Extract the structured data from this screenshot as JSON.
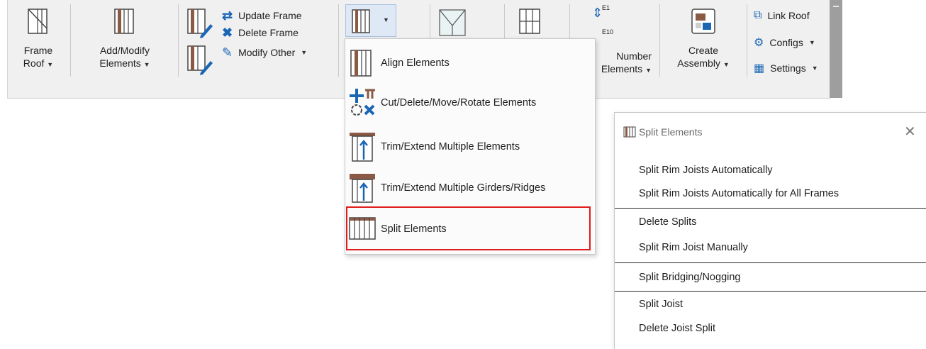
{
  "ribbon": {
    "frame_roof": {
      "line1": "Frame",
      "line2": "Roof"
    },
    "add_modify": {
      "line1": "Add/Modify",
      "line2": "Elements"
    },
    "update_frame": "Update Frame",
    "delete_frame": "Delete Frame",
    "modify_other": "Modify Other",
    "number_elements": {
      "line1": "Number",
      "line2": "Elements"
    },
    "number_label_top": "E1",
    "number_label_bottom": "E10",
    "create_assembly": {
      "line1": "Create",
      "line2": "Assembly"
    },
    "link_roof": "Link Roof",
    "configs": "Configs",
    "settings": "Settings"
  },
  "dropdown": {
    "items": [
      "Align Elements",
      "Cut/Delete/Move/Rotate Elements",
      "Trim/Extend Multiple Elements",
      "Trim/Extend Multiple Girders/Ridges",
      "Split Elements"
    ]
  },
  "split_panel": {
    "title": "Split Elements",
    "items": [
      "Split Rim Joists Automatically",
      "Split Rim Joists Automatically for All Frames",
      "Delete Splits",
      "Split Rim Joist Manually",
      "Split Bridging/Nogging",
      "Split Joist",
      "Delete Joist Split"
    ]
  },
  "colors": {
    "accent_blue": "#1a66b5",
    "highlight_red": "#e01b1b",
    "icon_brown": "#8a5a44",
    "ribbon_bg": "#f0f0f0"
  }
}
